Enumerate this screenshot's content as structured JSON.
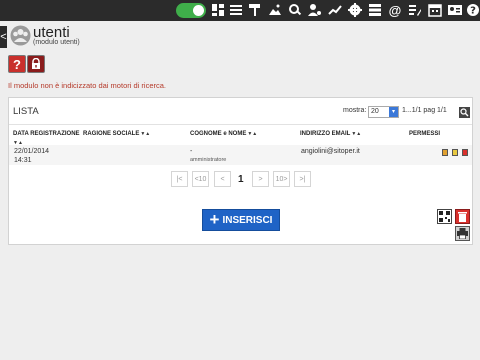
{
  "topbar": {
    "toggle_on": true,
    "icons": [
      "dashboard-icon",
      "menu-icon",
      "paint-roller-icon",
      "image-icon",
      "search-settings-icon",
      "user-settings-icon",
      "trending-icon",
      "gear-icon",
      "list-icon",
      "at-sign-icon",
      "edit-list-icon",
      "calendar-icon",
      "contact-card-icon",
      "help-icon"
    ]
  },
  "header": {
    "back_label": "<",
    "title": "utenti",
    "subtitle": "(modulo utenti)"
  },
  "toolbar": {
    "help_label": "?"
  },
  "notice": "Il modulo non è indicizzato dai motori di ricerca.",
  "list": {
    "title": "LISTA",
    "show_label": "mostra:",
    "show_value": "20",
    "page_info": "1...1/1 pag 1/1",
    "columns": [
      {
        "key": "date",
        "label": "DATA REGISTRAZIONE",
        "sortable": true
      },
      {
        "key": "company",
        "label": "RAGIONE SOCIALE",
        "sortable": true
      },
      {
        "key": "name",
        "label": "COGNOME e NOME",
        "sortable": true
      },
      {
        "key": "email",
        "label": "INDIRIZZO EMAIL",
        "sortable": true
      },
      {
        "key": "perms",
        "label": "PERMESSI",
        "sortable": false
      }
    ],
    "rows": [
      {
        "date": "22/01/2014",
        "time": "14:31",
        "company": "",
        "name": "-",
        "role": "amministratore",
        "email": "angiolini@sitoper.it",
        "actions": [
          "document-icon",
          "edit-icon",
          "delete-icon"
        ]
      }
    ],
    "pagination": {
      "first": "|<",
      "prev10": "<10",
      "prev": "<",
      "current": "1",
      "next": ">",
      "next10": "10>",
      "last": ">|"
    },
    "insert_label": "INSERISCI"
  },
  "colors": {
    "topbar": "#2b2b2b",
    "toggle": "#3fae4a",
    "insert_button": "#1f63c6",
    "notice": "#b53a2a",
    "help_button": "#c9302c"
  }
}
